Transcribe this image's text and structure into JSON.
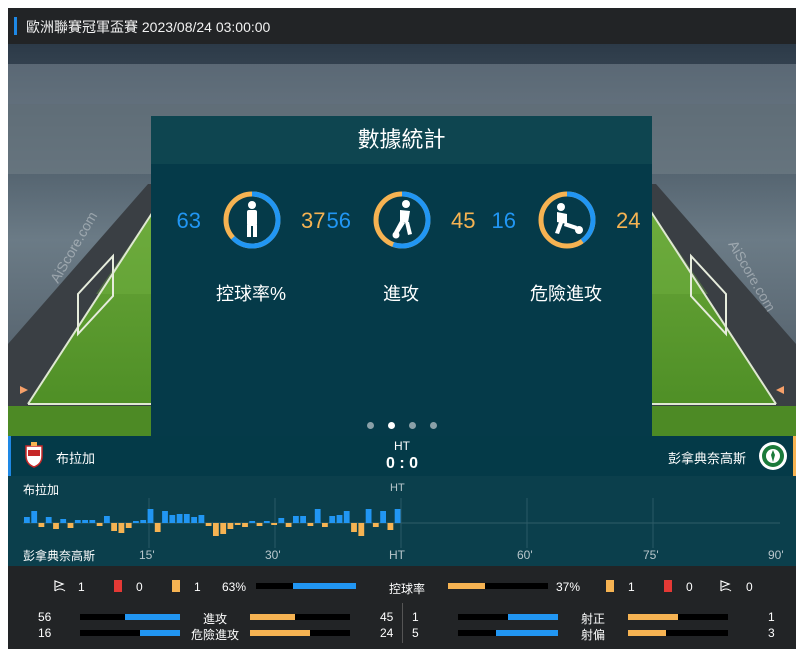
{
  "header": {
    "title": "歐洲聯賽冠軍盃賽 2023/08/24 03:00:00"
  },
  "panel": {
    "title": "數據統計",
    "stats": [
      {
        "label": "控球率%",
        "home": "63",
        "away": "37",
        "home_value": 63,
        "away_value": 37,
        "icon": "player-standing-icon"
      },
      {
        "label": "進攻",
        "home": "56",
        "away": "45",
        "home_value": 56,
        "away_value": 45,
        "icon": "player-running-icon"
      },
      {
        "label": "危險進攻",
        "home": "16",
        "away": "24",
        "home_value": 16,
        "away_value": 24,
        "icon": "player-kicking-icon"
      }
    ],
    "carousel": {
      "count": 4,
      "active": 2
    }
  },
  "match": {
    "home": "布拉加",
    "away": "彭拿典奈高斯",
    "period": "HT",
    "score": "0 : 0"
  },
  "timeline": {
    "home_label": "布拉加",
    "away_label": "彭拿典奈高斯",
    "ht_label": "HT",
    "ticks": [
      "15'",
      "30'",
      "HT",
      "60'",
      "75'",
      "90'"
    ],
    "momentum": [
      6,
      12,
      -4,
      6,
      -6,
      4,
      -5,
      3,
      3,
      3,
      -3,
      7,
      -8,
      -10,
      -5,
      2,
      3,
      14,
      -9,
      12,
      8,
      9,
      9,
      6,
      8,
      -3,
      -13,
      -11,
      -6,
      -2,
      -4,
      2,
      -3,
      2,
      -2,
      5,
      -4,
      7,
      7,
      -3,
      14,
      -4,
      7,
      8,
      12,
      -9,
      -13,
      14,
      -4,
      12,
      -7,
      14
    ]
  },
  "summary": {
    "home": {
      "corners": "1",
      "red": "0",
      "yellow": "1",
      "possession": "63%"
    },
    "away": {
      "corners": "0",
      "red": "0",
      "yellow": "1",
      "possession": "37%"
    },
    "possession_label": "控球率",
    "possession_home": 0.63,
    "possession_away": 0.37,
    "left_rows": [
      {
        "label": "進攻",
        "home": "56",
        "away": "45",
        "home_frac": 0.55,
        "away_frac": 0.45
      },
      {
        "label": "危險進攻",
        "home": "16",
        "away": "24",
        "home_frac": 0.4,
        "away_frac": 0.6
      }
    ],
    "right_rows": [
      {
        "label": "射正",
        "home": "1",
        "away": "1",
        "home_frac": 0.5,
        "away_frac": 0.5
      },
      {
        "label": "射偏",
        "home": "5",
        "away": "3",
        "home_frac": 0.62,
        "away_frac": 0.38
      }
    ]
  },
  "colors": {
    "home": "#2196f3",
    "away": "#f6b352",
    "panel": "#053a49",
    "red_card": "#e53935",
    "yellow_card": "#f6b352"
  }
}
